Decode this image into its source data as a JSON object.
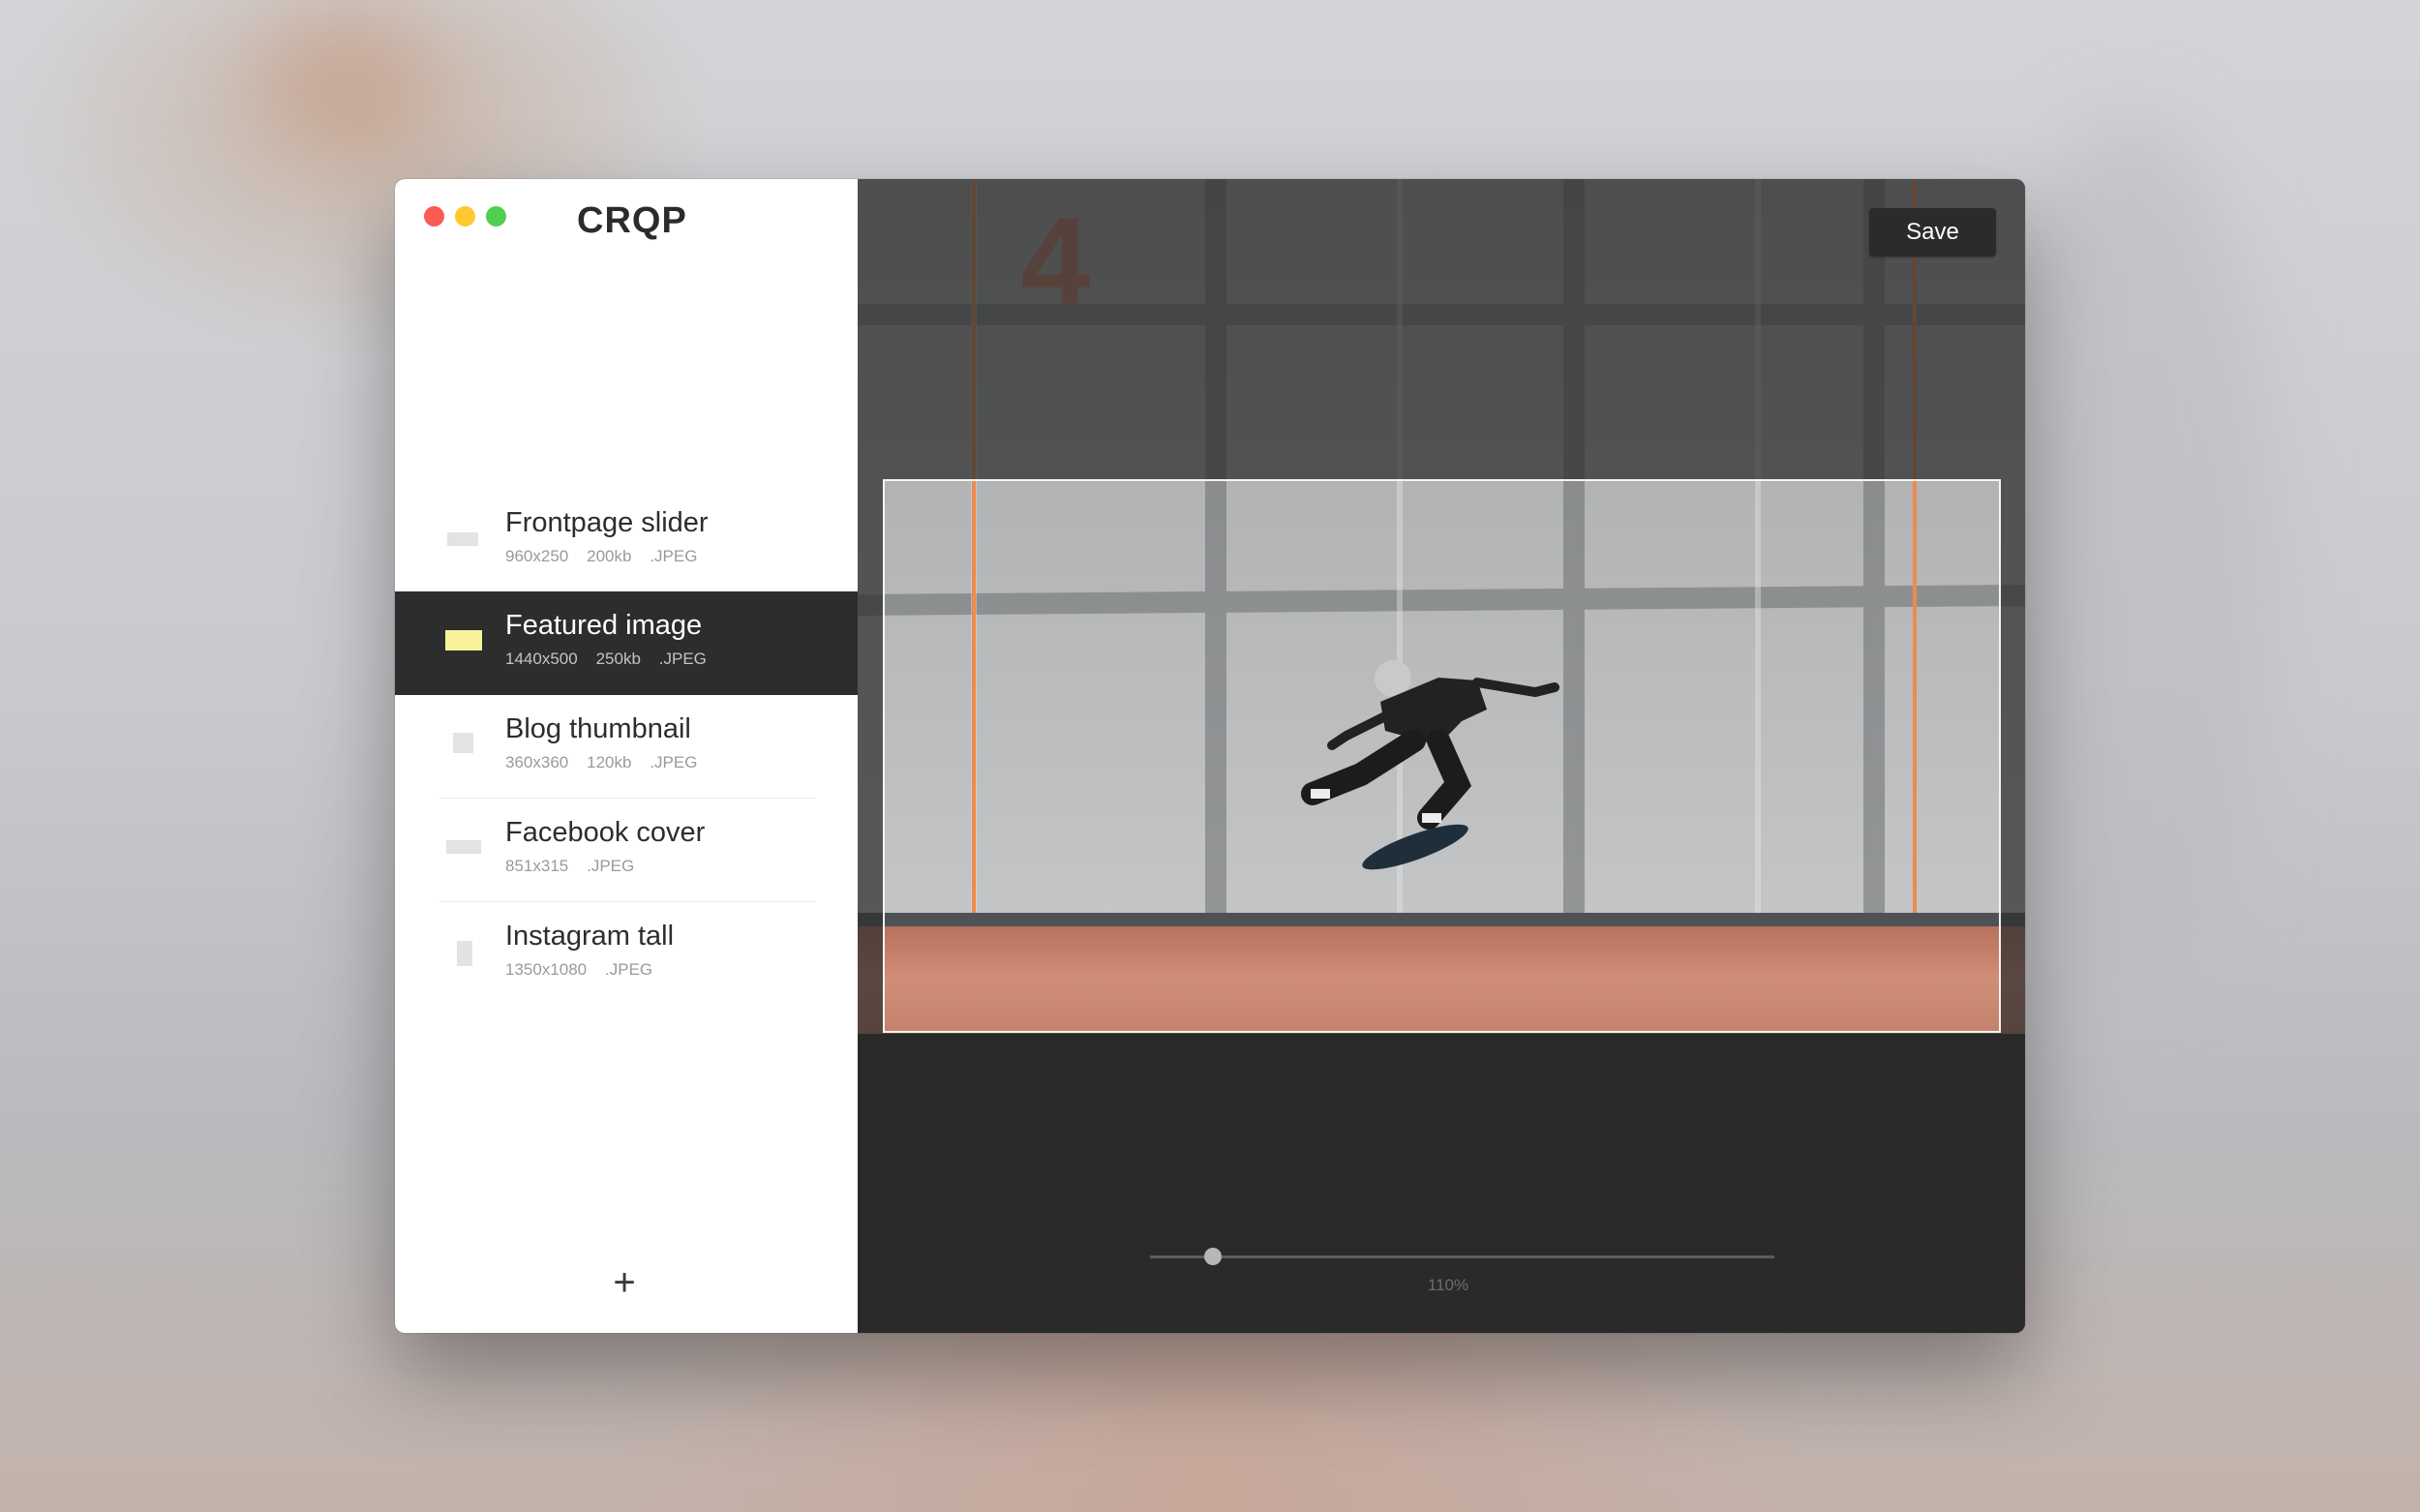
{
  "app": {
    "logo_text": "CRQP"
  },
  "window_controls": [
    "close",
    "minimize",
    "zoom"
  ],
  "sidebar": {
    "presets": [
      {
        "name": "Frontpage slider",
        "meta": "960x250    200kb    .JPEG",
        "active": false
      },
      {
        "name": "Featured image",
        "meta": "1440x500    250kb    .JPEG",
        "active": true
      },
      {
        "name": "Blog thumbnail",
        "meta": "360x360    120kb    .JPEG",
        "active": false
      },
      {
        "name": "Facebook cover",
        "meta": "851x315    .JPEG",
        "active": false
      },
      {
        "name": "Instagram tall",
        "meta": "1350x1080    .JPEG",
        "active": false
      }
    ],
    "add_label": "+"
  },
  "editor": {
    "save_label": "Save",
    "wall_number": "4",
    "zoom_level": 0.1,
    "zoom_label": "110%"
  },
  "colors": {
    "accent_yellow": "#f7f29c",
    "selected_row": "#2d2d2d",
    "editor_bg": "#2a2a2a",
    "floor_orange": "#c87a64"
  }
}
